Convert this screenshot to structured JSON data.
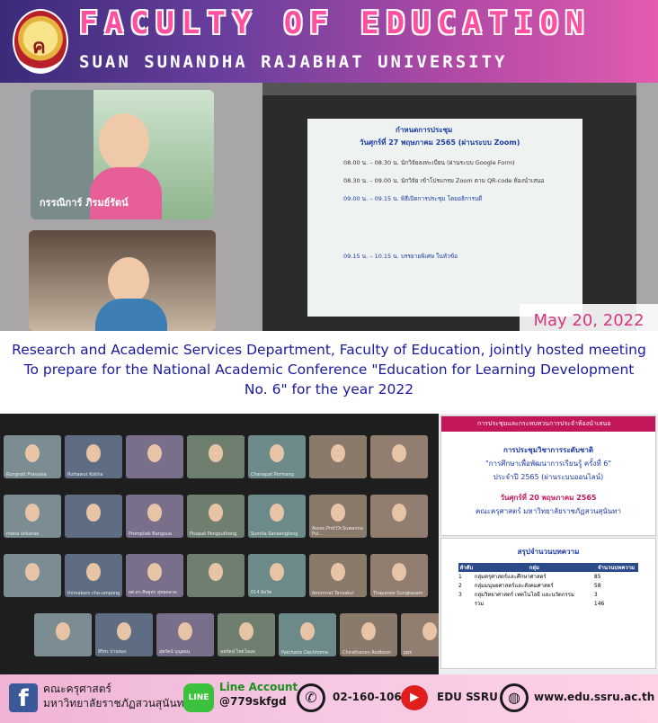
{
  "header": {
    "title": "FACULTY OF EDUCATION",
    "subtitle": "SUAN SUNANDHA RAJABHAT UNIVERSITY",
    "logo_glyph": "ค"
  },
  "photo": {
    "speaker_name": "กรรณิการ์ ภิรมย์รัตน์",
    "slide_title": "กำหนดการประชุม",
    "slide_date": "วันศุกร์ที่ 27 พฤษภาคม 2565 (ผ่านระบบ Zoom)",
    "slide_lines": [
      "08.00 น. – 08.30 น.   นักวิจัยลงทะเบียน (ผ่านระบบ Google Form)",
      "08.30 น. – 09.00 น.   นักวิจัย เข้าโปรแกรม Zoom ตาม QR-code ห้องนำเสนอ",
      "09.00 น. – 09.15 น.   พิธีเปิดการประชุม โดยอธิการบดี",
      "09.15 น. – 10.15 น.   บรรยายพิเศษ ในหัวข้อ"
    ],
    "date_badge": "May 20, 2022"
  },
  "caption": {
    "line1": "Research and Academic Services Department, Faculty of Education, jointly hosted meeting",
    "line2": "To prepare for the National Academic Conference \"Education for Learning Development",
    "line3": "No. 6\" for the year 2022"
  },
  "zoom_tiles": [
    "Rungratt Pransaia",
    "Ruttawut Kokha",
    "",
    "",
    "Chanapat Pormang",
    "",
    "",
    "mona unkarao",
    "",
    "Prompilak Bangsua",
    "Pisapat Pengsuthong",
    "Sumita Sanaengtong",
    "Assoc.Prof.Dr.Suwanna Pul...",
    "",
    "",
    "thimakorn cha-umpong",
    "ผศ.ดร.ศิษฐพร สุทธตลาด",
    "",
    "014 อิสวัต",
    "Amornrat Tansakul",
    "Thapanee Sungkasam",
    "",
    "สิริพร ปานทอง",
    "สุพรัตน์ บุญสอน",
    "นพรัตน์ ไชยโณสะ",
    "Patcharin Dechhome",
    "Chirathanon Rodboon",
    "ppk"
  ],
  "side_slides": {
    "top_bar": "การประชุมและกระทบทวนการประจำห้องนำเสนอ",
    "top_title": "การประชุมวิชาการระดับชาติ",
    "top_sub": "\"การศึกษาเพื่อพัฒนาการเรียนรู้ ครั้งที่ 6\"",
    "top_year": "ประจำปี 2565 (ผ่านระบบออนไลน์)",
    "top_date": "วันศุกร์ที่ 20 พฤษภาคม 2565",
    "top_org": "คณะครุศาสตร์ มหาวิทยาลัยราชภัฏสวนสุนันทา",
    "bot_title": "สรุปจำนวนบทความ",
    "table_headers": [
      "ลำดับ",
      "กลุ่ม",
      "จำนวนบทความ"
    ],
    "table_rows": [
      [
        "1",
        "กลุ่มครุศาสตร์และศึกษาศาสตร์",
        "85"
      ],
      [
        "2",
        "กลุ่มมนุษยศาสตร์และสังคมศาสตร์",
        "58"
      ],
      [
        "3",
        "กลุ่มวิทยาศาสตร์ เทคโนโลยี และนวัตกรรม",
        "3"
      ],
      [
        "",
        "รวม",
        "146"
      ]
    ]
  },
  "footer": {
    "fb_line1": "คณะครุศาสตร์",
    "fb_line2": "มหาวิทยาลัยราชภัฏสวนสุนันทา",
    "line_label": "Line Account",
    "line_id": "@779skfgd",
    "phone": "02-160-1062",
    "youtube": "EDU SSRU",
    "website": "www.edu.ssru.ac.th"
  }
}
